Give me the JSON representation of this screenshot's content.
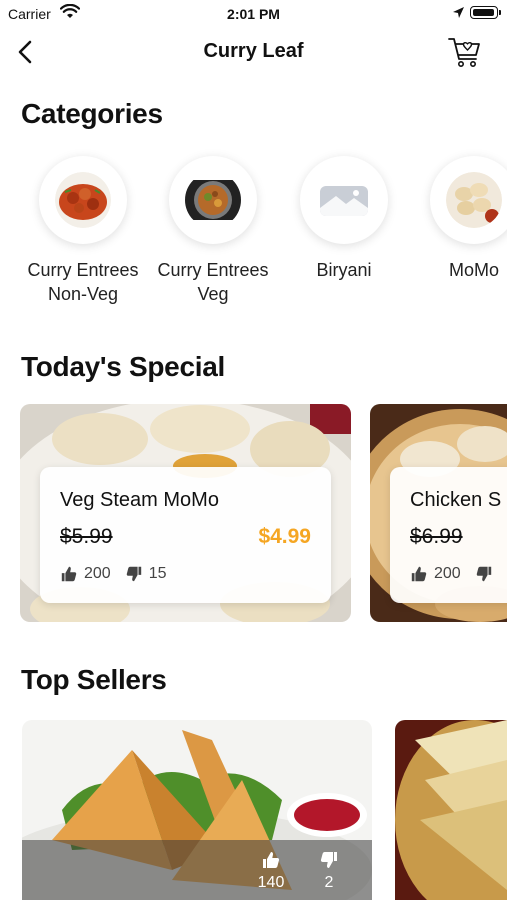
{
  "status_bar": {
    "carrier": "Carrier",
    "time": "2:01 PM"
  },
  "nav": {
    "title": "Curry Leaf"
  },
  "sections": {
    "categories": "Categories",
    "todays_special": "Today's Special",
    "top_sellers": "Top Sellers"
  },
  "categories": [
    {
      "label": "Curry Entrees Non-Veg"
    },
    {
      "label": "Curry Entrees Veg"
    },
    {
      "label": "Biryani"
    },
    {
      "label": "MoMo"
    }
  ],
  "specials": [
    {
      "name": "Veg Steam MoMo",
      "old_price": "$5.99",
      "new_price": "$4.99",
      "likes": "200",
      "dislikes": "15"
    },
    {
      "name": "Chicken S",
      "old_price": "$6.99",
      "new_price": "",
      "likes": "200",
      "dislikes": ""
    }
  ],
  "top_sellers": [
    {
      "likes": "140",
      "dislikes": "2"
    }
  ],
  "colors": {
    "accent": "#f5a623",
    "text": "#111111"
  }
}
